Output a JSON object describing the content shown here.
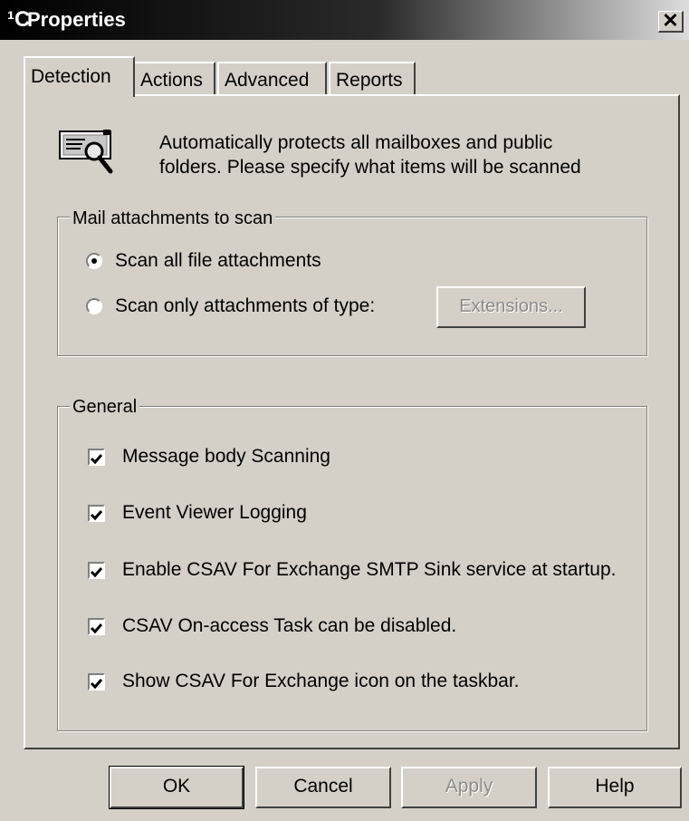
{
  "window": {
    "title_icon": "¹C",
    "title": "Properties",
    "close_label": "✕"
  },
  "tabs": [
    {
      "label": "Detection",
      "active": true
    },
    {
      "label": "Actions",
      "active": false
    },
    {
      "label": "Advanced",
      "active": false
    },
    {
      "label": "Reports",
      "active": false
    }
  ],
  "header": {
    "icon": "scan-document-icon",
    "line1": "Automatically protects all mailboxes and public",
    "line2": "folders. Please specify what items will be scanned"
  },
  "attachments_group": {
    "legend": "Mail attachments to scan",
    "option_all": {
      "label": "Scan all file attachments",
      "selected": true
    },
    "option_type": {
      "label": "Scan only attachments of type:",
      "selected": false
    },
    "extensions_button": "Extensions..."
  },
  "general_group": {
    "legend": "General",
    "items": [
      {
        "label": "Message body Scanning",
        "checked": true
      },
      {
        "label": "Event Viewer Logging",
        "checked": true
      },
      {
        "label": "Enable CSAV For Exchange SMTP Sink service at startup.",
        "checked": true
      },
      {
        "label": "CSAV On-access Task can be disabled.",
        "checked": true
      },
      {
        "label": "Show CSAV For Exchange icon on the taskbar.",
        "checked": true
      }
    ]
  },
  "buttons": {
    "ok": "OK",
    "cancel": "Cancel",
    "apply": "Apply",
    "help": "Help"
  }
}
